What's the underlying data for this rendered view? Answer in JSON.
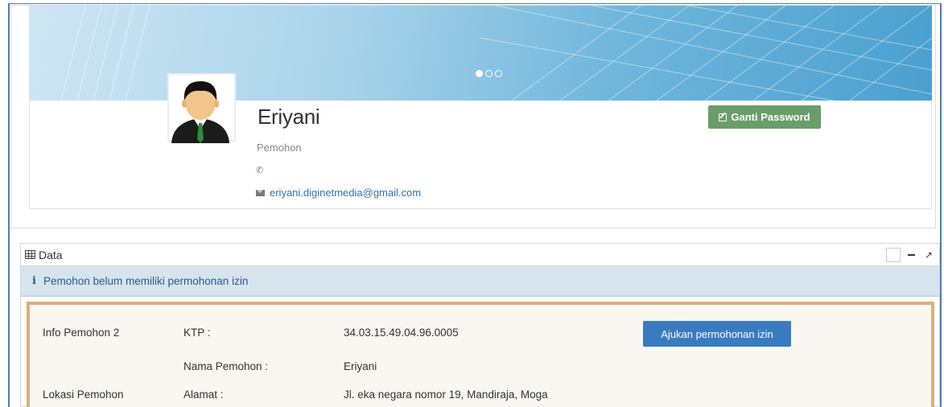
{
  "profile": {
    "name": "Eriyani",
    "role": "Pemohon",
    "email": "eriyani.diginetmedia@gmail.com",
    "change_password_label": "Ganti Password",
    "carousel": {
      "slides": 3,
      "active_index": 0
    }
  },
  "data_widget": {
    "title": "Data",
    "alert": "Pemohon belum memiliki permohonan izin",
    "apply_button_label": "Ajukan permohonan izin",
    "rows": [
      {
        "section": "Info Pemohon 2",
        "label": "KTP :",
        "value": "34.03.15.49.04.96.0005"
      },
      {
        "section": "",
        "label": "Nama Pemohon :",
        "value": "Eriyani"
      },
      {
        "section": "Lokasi Pemohon",
        "label": "Alamat :",
        "value": "Jl. eka negara nomor 19, Mandiraja, Moga"
      }
    ]
  },
  "colors": {
    "frame_border": "#4a7ec0",
    "success_button": "#6a9d6a",
    "primary_button": "#3a7bbf",
    "alert_bg": "#d6e4ee",
    "panel_border": "#dab07d"
  }
}
